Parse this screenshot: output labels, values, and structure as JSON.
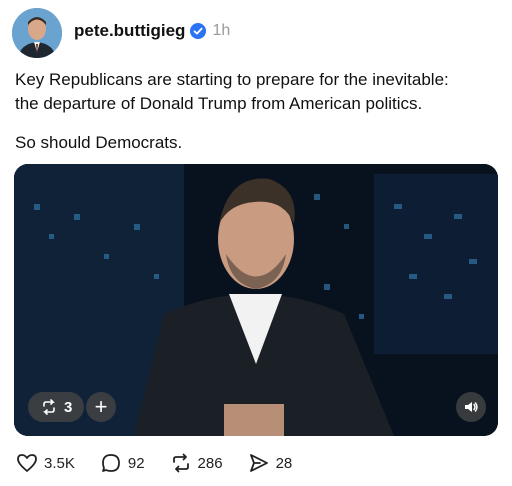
{
  "post": {
    "username": "pete.buttigieg",
    "time": "1h",
    "line1": "Key Republicans are starting to prepare for the inevitable:",
    "line2": "the departure of Donald Trump from American politics.",
    "line3": "So should Democrats."
  },
  "media": {
    "repost_count": "3",
    "plus_label": "+"
  },
  "actions": {
    "likes": "3.5K",
    "replies": "92",
    "reposts": "286",
    "shares": "28"
  },
  "colors": {
    "verified": "#2a73f5",
    "video_bg": "#0b1a2b"
  }
}
